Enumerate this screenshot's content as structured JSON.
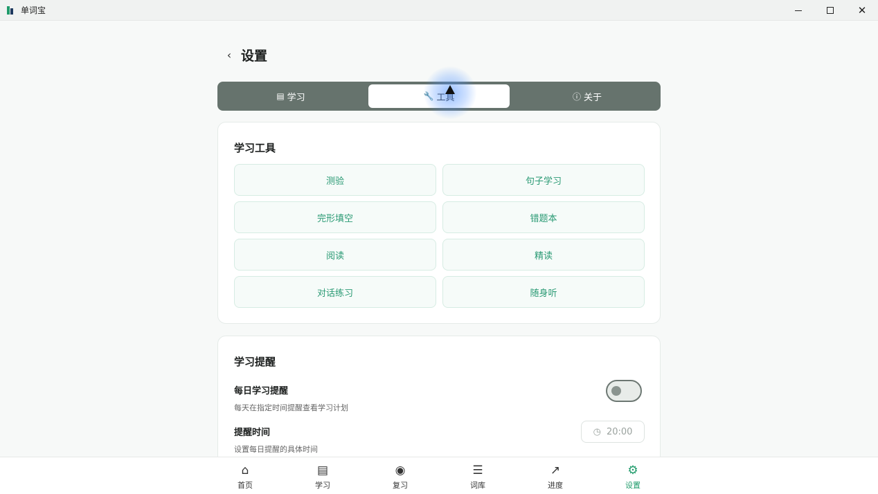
{
  "window": {
    "title": "单词宝"
  },
  "header": {
    "title": "设置"
  },
  "tabs": [
    {
      "label": "学习",
      "icon": "book-icon"
    },
    {
      "label": "工具",
      "icon": "wrench-icon"
    },
    {
      "label": "关于",
      "icon": "info-icon"
    }
  ],
  "tools_card": {
    "title": "学习工具",
    "items": [
      "测验",
      "句子学习",
      "完形填空",
      "错题本",
      "阅读",
      "精读",
      "对话练习",
      "随身听"
    ]
  },
  "reminder_card": {
    "title": "学习提醒",
    "daily": {
      "title": "每日学习提醒",
      "desc": "每天在指定时间提醒查看学习计划",
      "enabled": false
    },
    "time": {
      "title": "提醒时间",
      "desc": "设置每日提醒的具体时间",
      "value": "20:00"
    }
  },
  "bottom_nav": [
    {
      "label": "首页",
      "icon": "home-icon"
    },
    {
      "label": "学习",
      "icon": "book-icon"
    },
    {
      "label": "复习",
      "icon": "brain-icon"
    },
    {
      "label": "词库",
      "icon": "library-icon"
    },
    {
      "label": "进度",
      "icon": "trend-icon"
    },
    {
      "label": "设置",
      "icon": "gear-icon"
    }
  ],
  "colors": {
    "accent": "#1f9b6b",
    "segment_bg": "#66736d",
    "tool_text": "#2a9a74"
  }
}
